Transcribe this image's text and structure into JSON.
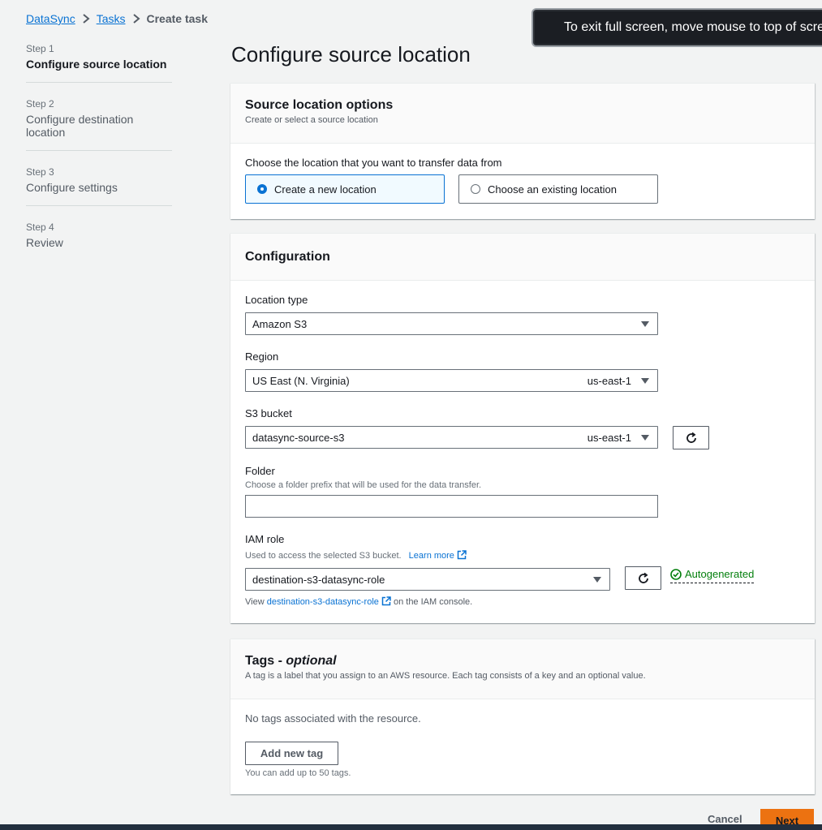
{
  "breadcrumb": {
    "items": [
      "DataSync",
      "Tasks"
    ],
    "current": "Create task"
  },
  "toast": {
    "text": "To exit full screen, move mouse to top of scre"
  },
  "steps": [
    {
      "num": "Step 1",
      "title": "Configure source location",
      "active": true
    },
    {
      "num": "Step 2",
      "title": "Configure destination location",
      "active": false
    },
    {
      "num": "Step 3",
      "title": "Configure settings",
      "active": false
    },
    {
      "num": "Step 4",
      "title": "Review",
      "active": false
    }
  ],
  "page_title": "Configure source location",
  "source_options": {
    "title": "Source location options",
    "description": "Create or select a source location",
    "question": "Choose the location that you want to transfer data from",
    "options": [
      "Create a new location",
      "Choose an existing location"
    ],
    "selected_index": 0
  },
  "configuration": {
    "title": "Configuration",
    "location_type": {
      "label": "Location type",
      "value": "Amazon S3"
    },
    "region": {
      "label": "Region",
      "value": "US East (N. Virginia)",
      "suffix": "us-east-1"
    },
    "s3_bucket": {
      "label": "S3 bucket",
      "value": "datasync-source-s3",
      "suffix": "us-east-1"
    },
    "folder": {
      "label": "Folder",
      "description": "Choose a folder prefix that will be used for the data transfer.",
      "value": ""
    },
    "iam_role": {
      "label": "IAM role",
      "description": "Used to access the selected S3 bucket.",
      "learn_more": "Learn more",
      "value": "destination-s3-datasync-role",
      "status": "Autogenerated",
      "view_prefix": "View",
      "view_link": "destination-s3-datasync-role",
      "view_suffix": "on the IAM console."
    }
  },
  "tags": {
    "title": "Tags",
    "title_suffix": "optional",
    "description": "A tag is a label that you assign to an AWS resource. Each tag consists of a key and an optional value.",
    "empty": "No tags associated with the resource.",
    "add_button": "Add new tag",
    "limit_note": "You can add up to 50 tags."
  },
  "footer": {
    "cancel": "Cancel",
    "next": "Next"
  },
  "colors": {
    "link": "#0972d3",
    "primary_button": "#ec7211",
    "success": "#037f0c",
    "background": "#f2f3f3"
  }
}
